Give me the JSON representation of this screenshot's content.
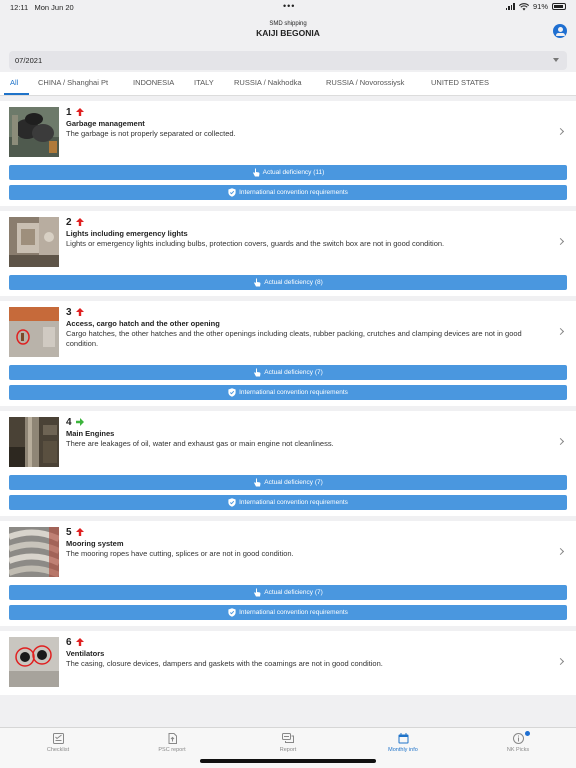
{
  "status": {
    "time": "12:11",
    "date": "Mon Jun 20",
    "battery": "91%"
  },
  "header": {
    "subtitle": "SMD shipping",
    "title": "KAIJI BEGONIA"
  },
  "month_select": {
    "value": "07/2021"
  },
  "tabs": [
    {
      "label": "All",
      "active": true
    },
    {
      "label": "CHINA / Shanghai Pt"
    },
    {
      "label": "INDONESIA"
    },
    {
      "label": "ITALY"
    },
    {
      "label": "RUSSIA / Nakhodka"
    },
    {
      "label": "RUSSIA / Novorossiysk"
    },
    {
      "label": "UNITED STATES"
    }
  ],
  "items": [
    {
      "number": "1",
      "trend": "up",
      "title": "Garbage management",
      "description": "The garbage is not properly separated or collected.",
      "actual_deficiency": "Actual deficiency (11)",
      "convention": "International convention requirements"
    },
    {
      "number": "2",
      "trend": "up",
      "title": "Lights including emergency lights",
      "description": "Lights or emergency lights including bulbs, protection covers, guards and the switch box are not in good condition.",
      "actual_deficiency": "Actual deficiency (8)"
    },
    {
      "number": "3",
      "trend": "up",
      "title": "Access, cargo hatch and the other opening",
      "description": "Cargo hatches, the other hatches and the other openings including cleats, rubber packing, crutches and clamping devices are not in good condition.",
      "actual_deficiency": "Actual deficiency (7)",
      "convention": "International convention requirements"
    },
    {
      "number": "4",
      "trend": "right",
      "title": "Main Engines",
      "description": "There are leakages of oil, water and exhaust gas or main engine not cleanliness.",
      "actual_deficiency": "Actual deficiency (7)",
      "convention": "International convention requirements"
    },
    {
      "number": "5",
      "trend": "up",
      "title": "Mooring system",
      "description": "The mooring ropes have cutting, splices or are not in good condition.",
      "actual_deficiency": "Actual deficiency (7)",
      "convention": "International convention requirements"
    },
    {
      "number": "6",
      "trend": "up",
      "title": "Ventilators",
      "description": "The casing, closure devices, dampers and gaskets with the coamings are not in good condition."
    }
  ],
  "tabbar": [
    {
      "label": "Checklist",
      "icon": "checklist-icon"
    },
    {
      "label": "PSC report",
      "icon": "document-icon"
    },
    {
      "label": "Report",
      "icon": "chat-icon"
    },
    {
      "label": "Monthly info",
      "icon": "calendar-icon",
      "active": true
    },
    {
      "label": "NK Picks",
      "icon": "info-icon"
    }
  ],
  "colors": {
    "accent": "#1f73c9",
    "button": "#4a97df",
    "trend_up": "#e02020",
    "trend_flat": "#3cb43c"
  }
}
